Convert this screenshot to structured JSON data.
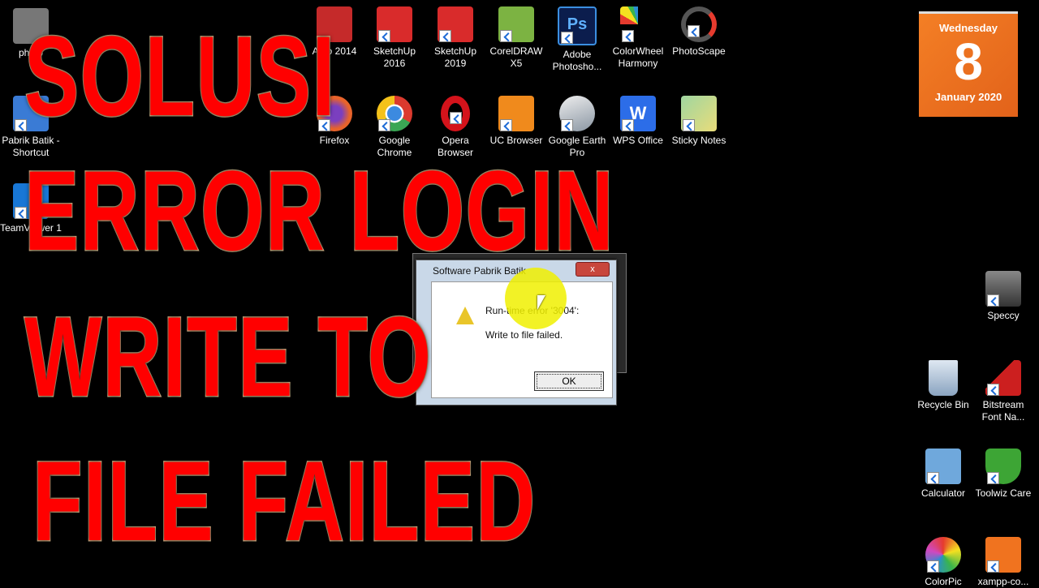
{
  "desktop": {
    "icons_left": [
      {
        "label": "photo",
        "icon": "photo-file-icon",
        "color": "#777777"
      },
      {
        "label": "Pabrik Batik - Shortcut",
        "icon": "network-computers-icon",
        "color": "#3a7bd5"
      },
      {
        "label": "TeamViewer 1",
        "icon": "teamviewer-icon",
        "color": "#1877d6"
      }
    ],
    "icons_top_row1": [
      {
        "label": "Auto 2014",
        "icon": "autocad-icon",
        "color": "#c52a2a"
      },
      {
        "label": "SketchUp 2016",
        "icon": "sketchup-icon",
        "color": "#d92b2b"
      },
      {
        "label": "SketchUp 2019",
        "icon": "sketchup-icon",
        "color": "#d92b2b"
      },
      {
        "label": "CorelDRAW X5",
        "icon": "coreldraw-icon",
        "color": "#7cb342"
      },
      {
        "label": "Adobe Photosho...",
        "icon": "photoshop-icon",
        "color": "#0b1d4d"
      },
      {
        "label": "ColorWheel Harmony",
        "icon": "colorwheel-icon",
        "color": "#e63b2e"
      },
      {
        "label": "PhotoScape",
        "icon": "photoscape-icon",
        "color": "#555555"
      }
    ],
    "icons_top_row2": [
      {
        "label": "Firefox",
        "icon": "firefox-icon",
        "color": "#e8632b"
      },
      {
        "label": "Google Chrome",
        "icon": "chrome-icon",
        "color": "#3c8ae0"
      },
      {
        "label": "Opera Browser",
        "icon": "opera-icon",
        "color": "#d4131b"
      },
      {
        "label": "UC Browser",
        "icon": "uc-browser-icon",
        "color": "#f08a1c"
      },
      {
        "label": "Google Earth Pro",
        "icon": "google-earth-icon",
        "color": "#9aa5b1"
      },
      {
        "label": "WPS Office",
        "icon": "wps-office-icon",
        "color": "#2c6de8"
      },
      {
        "label": "Sticky Notes",
        "icon": "sticky-notes-icon",
        "color": "#e9dc7a"
      }
    ],
    "icons_right": [
      {
        "label": "Speccy",
        "icon": "speccy-icon",
        "color": "#666666"
      },
      {
        "label": "Recycle Bin",
        "icon": "recycle-bin-icon",
        "color": "#b8c9dd"
      },
      {
        "label": "Bitstream Font Na...",
        "icon": "bitstream-icon",
        "color": "#cc1f1f"
      },
      {
        "label": "Calculator",
        "icon": "calculator-icon",
        "color": "#6fa8dc"
      },
      {
        "label": "Toolwiz Care",
        "icon": "toolwiz-icon",
        "color": "#3da535"
      },
      {
        "label": "ColorPic",
        "icon": "colorpic-icon",
        "color": "#d048c0"
      },
      {
        "label": "xampp-co...",
        "icon": "xampp-icon",
        "color": "#f0731f"
      }
    ]
  },
  "calendar": {
    "weekday": "Wednesday",
    "day": "8",
    "month_year": "January 2020",
    "color": "#f07522"
  },
  "dialog": {
    "title": "Software Pabrik Batik",
    "close_label": "x",
    "message_line1": "Run-time error '3004':",
    "message_line2": "Write to file failed.",
    "ok_label": "OK"
  },
  "overlay": {
    "line1": "SOLUSI",
    "line2": "ERROR LOGIN",
    "line3": "WRITE TO",
    "line4": "FILE FAILED",
    "color": "#ff0000"
  }
}
